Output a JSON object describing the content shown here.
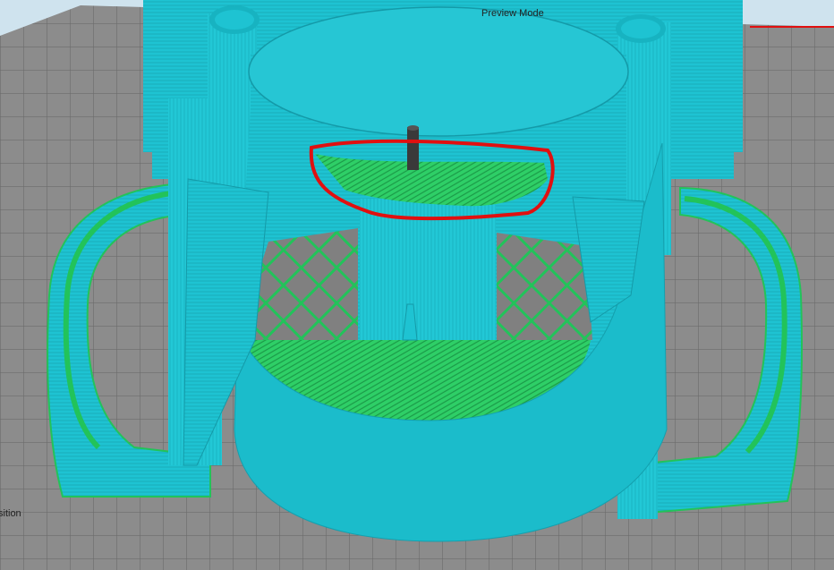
{
  "viewport": {
    "mode_label": "Preview Mode",
    "clipped_top_left": ")",
    "clipped_bottom_left": "sition"
  },
  "colors": {
    "background": "#cfe3ee",
    "bed": "#8c8c8c",
    "bed_grid": "#6b6b6b",
    "perimeter": "#1ec3d2",
    "infill": "#22c35a",
    "highlight": "#e01010",
    "nozzle": "#3a3a3a"
  },
  "icons": {
    "highlight": "red-ellipse-annotation",
    "nozzle": "nozzle-icon"
  }
}
